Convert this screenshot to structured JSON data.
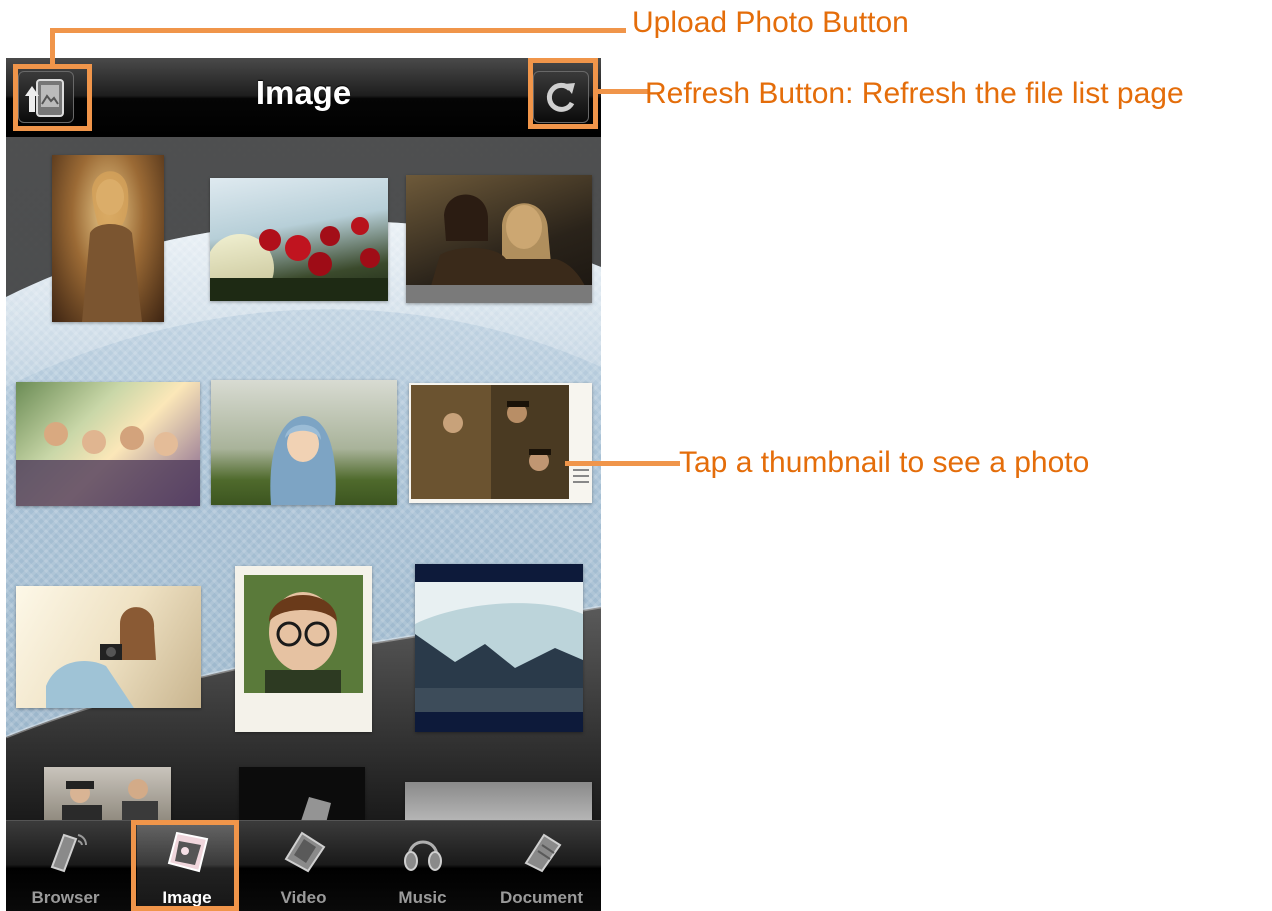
{
  "navbar": {
    "title": "Image"
  },
  "tabbar": {
    "tabs": [
      {
        "label": "Browser",
        "icon": "browser-icon",
        "active": false
      },
      {
        "label": "Image",
        "icon": "image-icon",
        "active": true
      },
      {
        "label": "Video",
        "icon": "video-icon",
        "active": false
      },
      {
        "label": "Music",
        "icon": "music-icon",
        "active": false
      },
      {
        "label": "Document",
        "icon": "document-icon",
        "active": false
      }
    ]
  },
  "annotations": {
    "upload": "Upload Photo Button",
    "refresh": "Refresh Button: Refresh the file list page",
    "thumbnail": "Tap a thumbnail to see a photo"
  },
  "colors": {
    "accent": "#f0954a",
    "annotation_text": "#e46d0a"
  }
}
